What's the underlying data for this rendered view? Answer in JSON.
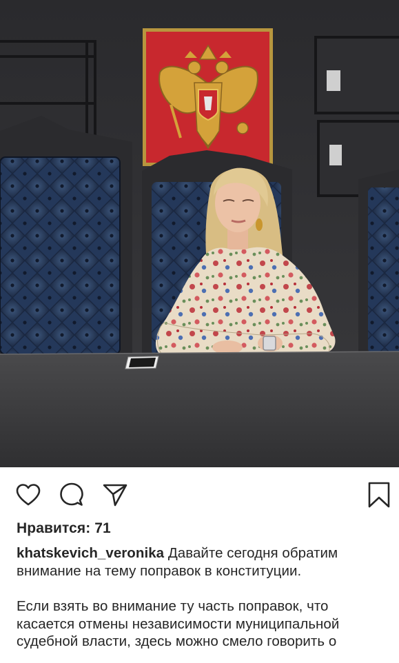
{
  "post": {
    "likes_label": "Нравится: 71",
    "username": "khatskevich_veronika",
    "caption_first": " Давайте сегодня обратим внимание на тему поправок в конституции.",
    "caption_second": "Если взять во внимание ту часть поправок, что касается отмены независимости муниципальной судебной власти, здесь можно смело говорить о"
  },
  "icons": {
    "like": "heart-icon",
    "comment": "comment-icon",
    "share": "paper-plane-icon",
    "save": "bookmark-icon"
  },
  "colors": {
    "text": "#262626",
    "background": "#ffffff",
    "wall": "#2b2b2e",
    "emblem_red": "#c8282e",
    "emblem_gold": "#d4a23a",
    "chair_blue": "#263a5a",
    "table": "#3c3c3e"
  }
}
